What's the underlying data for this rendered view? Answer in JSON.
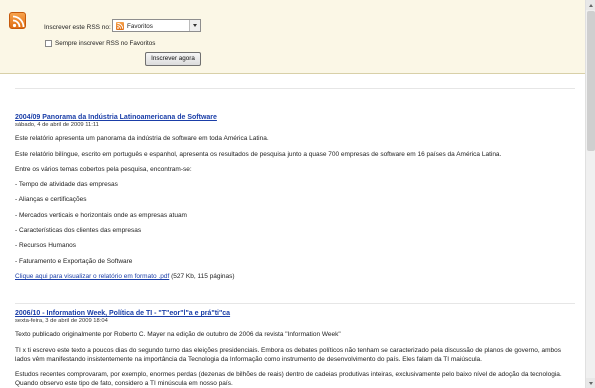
{
  "subscribe": {
    "label": "Inscrever este RSS no:",
    "selected_feed": "Favoritos",
    "always_label": "Sempre inscrever RSS no Favoritos",
    "always_checked": false,
    "button_label": "Inscrever agora",
    "icon": "rss-feed-icon"
  },
  "entries": [
    {
      "title": "2004/09 Panorama da Indústria Latinoamericana de Software",
      "date": "sábado, 4 de abril de 2009 11:11",
      "paragraphs": [
        "Este relatório apresenta um panorama da indústria de software em toda América Latina.",
        "Este relatório bilíngue, escrito em português e espanhol, apresenta os resultados de pesquisa junto a quase 700 empresas de software em 16 países da América Latina.",
        "Entre os vários temas cobertos pela pesquisa, encontram-se:",
        "- Tempo de atividade das empresas",
        "- Alianças e certificações",
        "- Mercados verticais e horizontais onde as empresas atuam",
        "- Características dos clientes das empresas",
        "- Recursos Humanos",
        "- Faturamento e Exportação de Software"
      ],
      "link_text": "Clique aqui para visualizar o relatório em formato .pdf",
      "link_suffix": " (527 Kb, 115 páginas)"
    },
    {
      "title": "2006/10 - Information Week, Política de TI - \"T\"eor\"l\"a e prá\"ti\"ca",
      "date": "sexta-feira, 3 de abril de 2009 18:04",
      "paragraphs": [
        "Texto publicado originalmente por Roberto C. Mayer na edição de outubro de 2006 da revista \"Information Week\"",
        "TI x ti escrevo este texto a poucos dias do segundo turno das eleições presidenciais. Embora os debates políticos não tenham se caracterizado pela discussão de planos de governo, ambos lados vêm manifestando insistentemente na importância da Tecnologia da Informação como instrumento de desenvolvimento do país. Eles falam da TI maiúscula.",
        "Estudos recentes comprovaram, por exemplo, enormes perdas (dezenas de bilhões de reais) dentro de cadeias produtivas inteiras, exclusivamente pelo baixo nível de adoção da tecnologia. Quando observo este tipo de fato, considero a TI minúscula em nosso país."
      ]
    }
  ]
}
